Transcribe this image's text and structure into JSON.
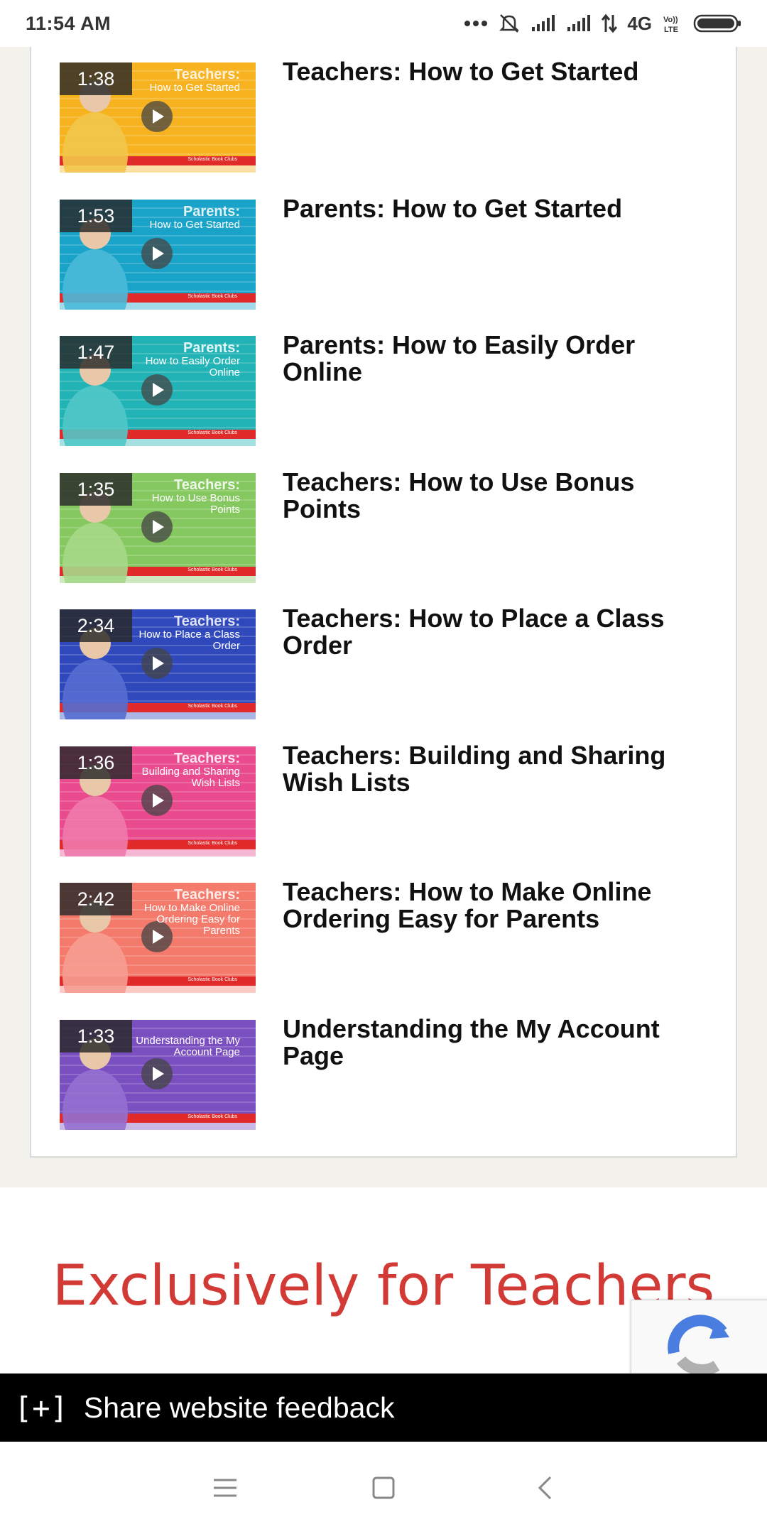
{
  "status_bar": {
    "time": "11:54 AM",
    "network": "4G",
    "volte": "Vo)) LTE"
  },
  "videos": [
    {
      "duration": "1:38",
      "title": "Teachers: How to Get Started",
      "thumb_heading": "Teachers:",
      "thumb_sub": "How to Get Started",
      "bg": "#f7b21f",
      "accent": "#f2c64a"
    },
    {
      "duration": "1:53",
      "title": "Parents: How to Get Started",
      "thumb_heading": "Parents:",
      "thumb_sub": "How to Get Started",
      "bg": "#1aa3c8",
      "accent": "#4ab9d8"
    },
    {
      "duration": "1:47",
      "title": "Parents: How to Easily Order Online",
      "thumb_heading": "Parents:",
      "thumb_sub": "How to Easily Order Online",
      "bg": "#22b3b6",
      "accent": "#51c6c8"
    },
    {
      "duration": "1:35",
      "title": "Teachers: How to Use Bonus Points",
      "thumb_heading": "Teachers:",
      "thumb_sub": "How to Use Bonus Points",
      "bg": "#86c860",
      "accent": "#a6d888"
    },
    {
      "duration": "2:34",
      "title": "Teachers: How to Place a Class Order",
      "thumb_heading": "Teachers:",
      "thumb_sub": "How to Place a Class Order",
      "bg": "#2f49bd",
      "accent": "#566ed0"
    },
    {
      "duration": "1:36",
      "title": "Teachers: Building and Sharing Wish Lists",
      "thumb_heading": "Teachers:",
      "thumb_sub": "Building and Sharing Wish Lists",
      "bg": "#e94b8e",
      "accent": "#f07aab"
    },
    {
      "duration": "2:42",
      "title": "Teachers: How to Make Online Ordering Easy for Parents",
      "thumb_heading": "Teachers:",
      "thumb_sub": "How to Make Online Ordering Easy for Parents",
      "bg": "#f47a6c",
      "accent": "#f79d92"
    },
    {
      "duration": "1:33",
      "title": "Understanding the My Account Page",
      "thumb_heading": "",
      "thumb_sub": "Understanding the My Account Page",
      "bg": "#7a4fc0",
      "accent": "#9470d0"
    }
  ],
  "thumb_brand": "Scholastic Book Clubs",
  "exclusive": {
    "title": "Exclusively for Teachers"
  },
  "feedback": {
    "icon_text": "[+]",
    "label": "Share website feedback"
  },
  "colors": {
    "exclusive_red": "#d23a36",
    "thumb_red_band": "#e12b2b"
  }
}
